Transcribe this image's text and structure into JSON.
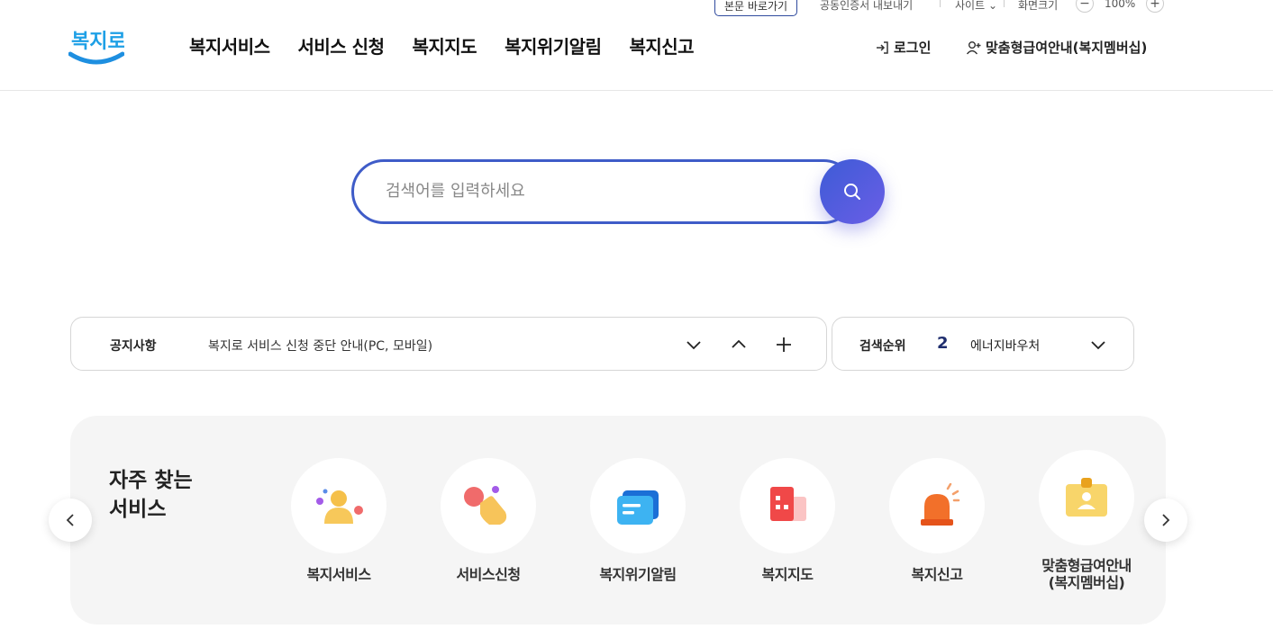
{
  "util": {
    "skip_label": "본문 바로가기",
    "cert_label": "공동인증서 내보내기",
    "site_label": "사이트",
    "zoom_label": "화면크기",
    "zoom_value": "100%",
    "zoom_minus": "−",
    "zoom_plus": "+"
  },
  "header": {
    "logo_text": "복지로",
    "nav": [
      "복지서비스",
      "서비스 신청",
      "복지지도",
      "복지위기알림",
      "복지신고"
    ],
    "login_label": "로그인",
    "membership_label": "맞춤형급여안내(복지멤버십)"
  },
  "search": {
    "placeholder": "검색어를 입력하세요"
  },
  "notice": {
    "label": "공지사항",
    "text": "복지로 서비스 신청 중단 안내(PC, 모바일)"
  },
  "rank": {
    "label": "검색순위",
    "number": "2",
    "keyword": "에너지바우처"
  },
  "frequent": {
    "title": "자주 찾는 서비스",
    "items": [
      {
        "label": "복지서비스",
        "icon": "person-icon"
      },
      {
        "label": "서비스신청",
        "icon": "tap-hand-icon"
      },
      {
        "label": "복지위기알림",
        "icon": "message-card-icon"
      },
      {
        "label": "복지지도",
        "icon": "building-icon"
      },
      {
        "label": "복지신고",
        "icon": "siren-icon"
      },
      {
        "label": "맞춤형급여안내(복지멤버십)",
        "icon": "id-badge-icon"
      }
    ]
  },
  "colors": {
    "brand_blue": "#3f5cc8",
    "logo_blue": "#1ea0e6",
    "panel_gray": "#f5f5f5"
  }
}
